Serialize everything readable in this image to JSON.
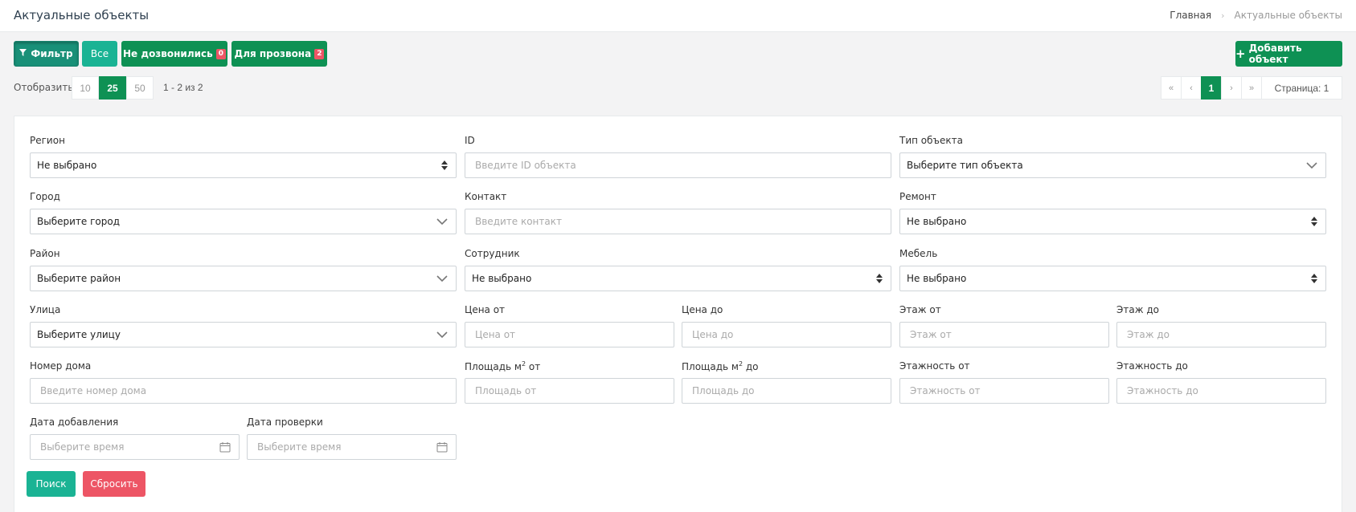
{
  "header": {
    "title": "Актуальные объекты",
    "breadcrumb": {
      "home": "Главная",
      "current": "Актуальные объекты"
    }
  },
  "toolbar": {
    "filter_label": "Фильтр",
    "all_label": "Все",
    "no_call_label": "Не дозвонились",
    "no_call_count": "0",
    "to_call_label": "Для прозвона",
    "to_call_count": "2",
    "add_label": "Добавить объект"
  },
  "paging": {
    "show_label": "Отобразить:",
    "sizes": [
      "10",
      "25",
      "50"
    ],
    "active_size": "25",
    "range_text": "1 - 2 из 2",
    "nav": {
      "first": "«",
      "prev": "‹",
      "current": "1",
      "next": "›",
      "last": "»"
    },
    "page_indicator": "Страница: 1"
  },
  "filters": {
    "region": {
      "label": "Регион",
      "value": "Не выбрано"
    },
    "id": {
      "label": "ID",
      "placeholder": "Введите ID объекта"
    },
    "object_type": {
      "label": "Тип объекта",
      "value": "Выберите тип объекта"
    },
    "city": {
      "label": "Город",
      "value": "Выберите город"
    },
    "contact": {
      "label": "Контакт",
      "placeholder": "Введите контакт"
    },
    "repair": {
      "label": "Ремонт",
      "value": "Не выбрано"
    },
    "district": {
      "label": "Район",
      "value": "Выберите район"
    },
    "employee": {
      "label": "Сотрудник",
      "value": "Не выбрано"
    },
    "furniture": {
      "label": "Мебель",
      "value": "Не выбрано"
    },
    "street": {
      "label": "Улица",
      "value": "Выберите улицу"
    },
    "price_from": {
      "label": "Цена от",
      "placeholder": "Цена от"
    },
    "price_to": {
      "label": "Цена до",
      "placeholder": "Цена до"
    },
    "floor_from": {
      "label": "Этаж от",
      "placeholder": "Этаж от"
    },
    "floor_to": {
      "label": "Этаж до",
      "placeholder": "Этаж до"
    },
    "house_number": {
      "label": "Номер дома",
      "placeholder": "Введите номер дома"
    },
    "area_from": {
      "label_prefix": "Площадь м",
      "label_sup": "2",
      "label_suffix": " от",
      "placeholder": "Площадь от"
    },
    "area_to": {
      "label_prefix": "Площадь м",
      "label_sup": "2",
      "label_suffix": " до",
      "placeholder": "Площадь до"
    },
    "floors_from": {
      "label": "Этажность от",
      "placeholder": "Этажность от"
    },
    "floors_to": {
      "label": "Этажность до",
      "placeholder": "Этажность до"
    },
    "date_added": {
      "label": "Дата добавления",
      "placeholder": "Выберите время"
    },
    "date_checked": {
      "label": "Дата проверки",
      "placeholder": "Выберите время"
    }
  },
  "actions": {
    "search_label": "Поиск",
    "reset_label": "Сбросить"
  },
  "colors": {
    "primary": "#1ab394",
    "dark_green": "#0e9154",
    "danger": "#ed5565"
  }
}
